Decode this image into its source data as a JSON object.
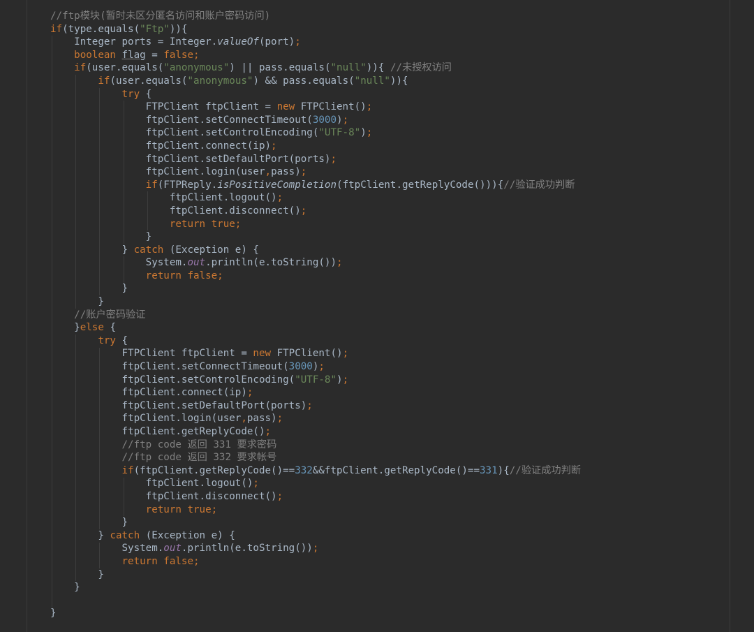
{
  "colors": {
    "background": "#2b2b2b",
    "plain": "#a9b7c6",
    "keyword": "#cc7832",
    "string": "#6a8759",
    "number": "#6897bb",
    "comment": "#808080",
    "static_field": "#9876aa"
  },
  "editor": {
    "lines": [
      {
        "indent": 0,
        "tokens": [
          [
            "cmt",
            "//ftp模块(暂时未区分匿名访问和账户密码访问)"
          ]
        ]
      },
      {
        "indent": 0,
        "tokens": [
          [
            "kw",
            "if"
          ],
          [
            "pl",
            "(type.equals("
          ],
          [
            "str",
            "\"Ftp\""
          ],
          [
            "pl",
            "))"
          ],
          [
            "pl",
            "{"
          ]
        ]
      },
      {
        "indent": 1,
        "tokens": [
          [
            "pl",
            "Integer ports = Integer."
          ],
          [
            "ita",
            "valueOf"
          ],
          [
            "pl",
            "(port)"
          ],
          [
            "kw",
            ";"
          ]
        ]
      },
      {
        "indent": 1,
        "tokens": [
          [
            "kw",
            "boolean "
          ],
          [
            "und",
            "flag"
          ],
          [
            "pl",
            " = "
          ],
          [
            "kw",
            "false;"
          ]
        ]
      },
      {
        "indent": 1,
        "tokens": [
          [
            "kw",
            "if"
          ],
          [
            "pl",
            "(user.equals("
          ],
          [
            "str",
            "\"anonymous\""
          ],
          [
            "pl",
            ") || pass.equals("
          ],
          [
            "str",
            "\"null\""
          ],
          [
            "pl",
            "))"
          ],
          [
            "pl",
            "{ "
          ],
          [
            "cmt",
            "//未授权访问"
          ]
        ]
      },
      {
        "indent": 2,
        "tokens": [
          [
            "kw",
            "if"
          ],
          [
            "pl",
            "(user.equals("
          ],
          [
            "str",
            "\"anonymous\""
          ],
          [
            "pl",
            ") && pass.equals("
          ],
          [
            "str",
            "\"null\""
          ],
          [
            "pl",
            "))"
          ],
          [
            "pl",
            "{"
          ]
        ]
      },
      {
        "indent": 3,
        "tokens": [
          [
            "kw",
            "try "
          ],
          [
            "pl",
            "{"
          ]
        ]
      },
      {
        "indent": 4,
        "tokens": [
          [
            "pl",
            "FTPClient ftpClient = "
          ],
          [
            "kw",
            "new "
          ],
          [
            "pl",
            "FTPClient()"
          ],
          [
            "kw",
            ";"
          ]
        ]
      },
      {
        "indent": 4,
        "tokens": [
          [
            "pl",
            "ftpClient.setConnectTimeout("
          ],
          [
            "num",
            "3000"
          ],
          [
            "pl",
            ")"
          ],
          [
            "kw",
            ";"
          ]
        ]
      },
      {
        "indent": 4,
        "tokens": [
          [
            "pl",
            "ftpClient.setControlEncoding("
          ],
          [
            "str",
            "\"UTF-8\""
          ],
          [
            "pl",
            ")"
          ],
          [
            "kw",
            ";"
          ]
        ]
      },
      {
        "indent": 4,
        "tokens": [
          [
            "pl",
            "ftpClient.connect(ip)"
          ],
          [
            "kw",
            ";"
          ]
        ]
      },
      {
        "indent": 4,
        "tokens": [
          [
            "pl",
            "ftpClient.setDefaultPort(ports)"
          ],
          [
            "kw",
            ";"
          ]
        ]
      },
      {
        "indent": 4,
        "tokens": [
          [
            "pl",
            "ftpClient.login(user"
          ],
          [
            "kw",
            ","
          ],
          [
            "pl",
            "pass)"
          ],
          [
            "kw",
            ";"
          ]
        ]
      },
      {
        "indent": 4,
        "tokens": [
          [
            "kw",
            "if"
          ],
          [
            "pl",
            "(FTPReply."
          ],
          [
            "ita",
            "isPositiveCompletion"
          ],
          [
            "pl",
            "(ftpClient.getReplyCode()))"
          ],
          [
            "pl",
            "{"
          ],
          [
            "cmt",
            "//验证成功判断"
          ]
        ]
      },
      {
        "indent": 5,
        "tokens": [
          [
            "pl",
            "ftpClient.logout()"
          ],
          [
            "kw",
            ";"
          ]
        ]
      },
      {
        "indent": 5,
        "tokens": [
          [
            "pl",
            "ftpClient.disconnect()"
          ],
          [
            "kw",
            ";"
          ]
        ]
      },
      {
        "indent": 5,
        "tokens": [
          [
            "kw",
            "return true;"
          ]
        ]
      },
      {
        "indent": 4,
        "tokens": [
          [
            "pl",
            "}"
          ]
        ]
      },
      {
        "indent": 3,
        "tokens": [
          [
            "pl",
            "} "
          ],
          [
            "kw",
            "catch "
          ],
          [
            "pl",
            "(Exception e) {"
          ]
        ]
      },
      {
        "indent": 4,
        "tokens": [
          [
            "pl",
            "System."
          ],
          [
            "sta",
            "out"
          ],
          [
            "pl",
            ".println(e.toString())"
          ],
          [
            "kw",
            ";"
          ]
        ]
      },
      {
        "indent": 4,
        "tokens": [
          [
            "kw",
            "return false;"
          ]
        ]
      },
      {
        "indent": 3,
        "tokens": [
          [
            "pl",
            "}"
          ]
        ]
      },
      {
        "indent": 2,
        "tokens": [
          [
            "pl",
            "}"
          ]
        ]
      },
      {
        "indent": 1,
        "tokens": [
          [
            "cmt",
            "//账户密码验证"
          ]
        ]
      },
      {
        "indent": 1,
        "tokens": [
          [
            "pl",
            "}"
          ],
          [
            "kw",
            "else "
          ],
          [
            "pl",
            "{"
          ]
        ]
      },
      {
        "indent": 2,
        "tokens": [
          [
            "kw",
            "try "
          ],
          [
            "pl",
            "{"
          ]
        ]
      },
      {
        "indent": 3,
        "tokens": [
          [
            "pl",
            "FTPClient ftpClient = "
          ],
          [
            "kw",
            "new "
          ],
          [
            "pl",
            "FTPClient()"
          ],
          [
            "kw",
            ";"
          ]
        ]
      },
      {
        "indent": 3,
        "tokens": [
          [
            "pl",
            "ftpClient.setConnectTimeout("
          ],
          [
            "num",
            "3000"
          ],
          [
            "pl",
            ")"
          ],
          [
            "kw",
            ";"
          ]
        ]
      },
      {
        "indent": 3,
        "tokens": [
          [
            "pl",
            "ftpClient.setControlEncoding("
          ],
          [
            "str",
            "\"UTF-8\""
          ],
          [
            "pl",
            ")"
          ],
          [
            "kw",
            ";"
          ]
        ]
      },
      {
        "indent": 3,
        "tokens": [
          [
            "pl",
            "ftpClient.connect(ip)"
          ],
          [
            "kw",
            ";"
          ]
        ]
      },
      {
        "indent": 3,
        "tokens": [
          [
            "pl",
            "ftpClient.setDefaultPort(ports)"
          ],
          [
            "kw",
            ";"
          ]
        ]
      },
      {
        "indent": 3,
        "tokens": [
          [
            "pl",
            "ftpClient.login(user"
          ],
          [
            "kw",
            ","
          ],
          [
            "pl",
            "pass)"
          ],
          [
            "kw",
            ";"
          ]
        ]
      },
      {
        "indent": 3,
        "tokens": [
          [
            "pl",
            "ftpClient.getReplyCode()"
          ],
          [
            "kw",
            ";"
          ]
        ]
      },
      {
        "indent": 3,
        "tokens": [
          [
            "cmt",
            "//ftp code 返回 331 要求密码"
          ]
        ]
      },
      {
        "indent": 3,
        "tokens": [
          [
            "cmt",
            "//ftp code 返回 332 要求帐号"
          ]
        ]
      },
      {
        "indent": 3,
        "tokens": [
          [
            "kw",
            "if"
          ],
          [
            "pl",
            "(ftpClient.getReplyCode()=="
          ],
          [
            "num",
            "332"
          ],
          [
            "pl",
            "&&ftpClient.getReplyCode()=="
          ],
          [
            "num",
            "331"
          ],
          [
            "pl",
            ")"
          ],
          [
            "pl",
            "{"
          ],
          [
            "cmt",
            "//验证成功判断"
          ]
        ]
      },
      {
        "indent": 4,
        "tokens": [
          [
            "pl",
            "ftpClient.logout()"
          ],
          [
            "kw",
            ";"
          ]
        ]
      },
      {
        "indent": 4,
        "tokens": [
          [
            "pl",
            "ftpClient.disconnect()"
          ],
          [
            "kw",
            ";"
          ]
        ]
      },
      {
        "indent": 4,
        "tokens": [
          [
            "kw",
            "return true;"
          ]
        ]
      },
      {
        "indent": 3,
        "tokens": [
          [
            "pl",
            "}"
          ]
        ]
      },
      {
        "indent": 2,
        "tokens": [
          [
            "pl",
            "} "
          ],
          [
            "kw",
            "catch "
          ],
          [
            "pl",
            "(Exception e) {"
          ]
        ]
      },
      {
        "indent": 3,
        "tokens": [
          [
            "pl",
            "System."
          ],
          [
            "sta",
            "out"
          ],
          [
            "pl",
            ".println(e.toString())"
          ],
          [
            "kw",
            ";"
          ]
        ]
      },
      {
        "indent": 3,
        "tokens": [
          [
            "kw",
            "return false;"
          ]
        ]
      },
      {
        "indent": 2,
        "tokens": [
          [
            "pl",
            "}"
          ]
        ]
      },
      {
        "indent": 1,
        "tokens": [
          [
            "pl",
            "}"
          ]
        ]
      },
      {
        "indent": 0,
        "tokens": [
          [
            "pl",
            ""
          ]
        ]
      },
      {
        "indent": 0,
        "tokens": [
          [
            "pl",
            "}"
          ]
        ]
      }
    ]
  }
}
